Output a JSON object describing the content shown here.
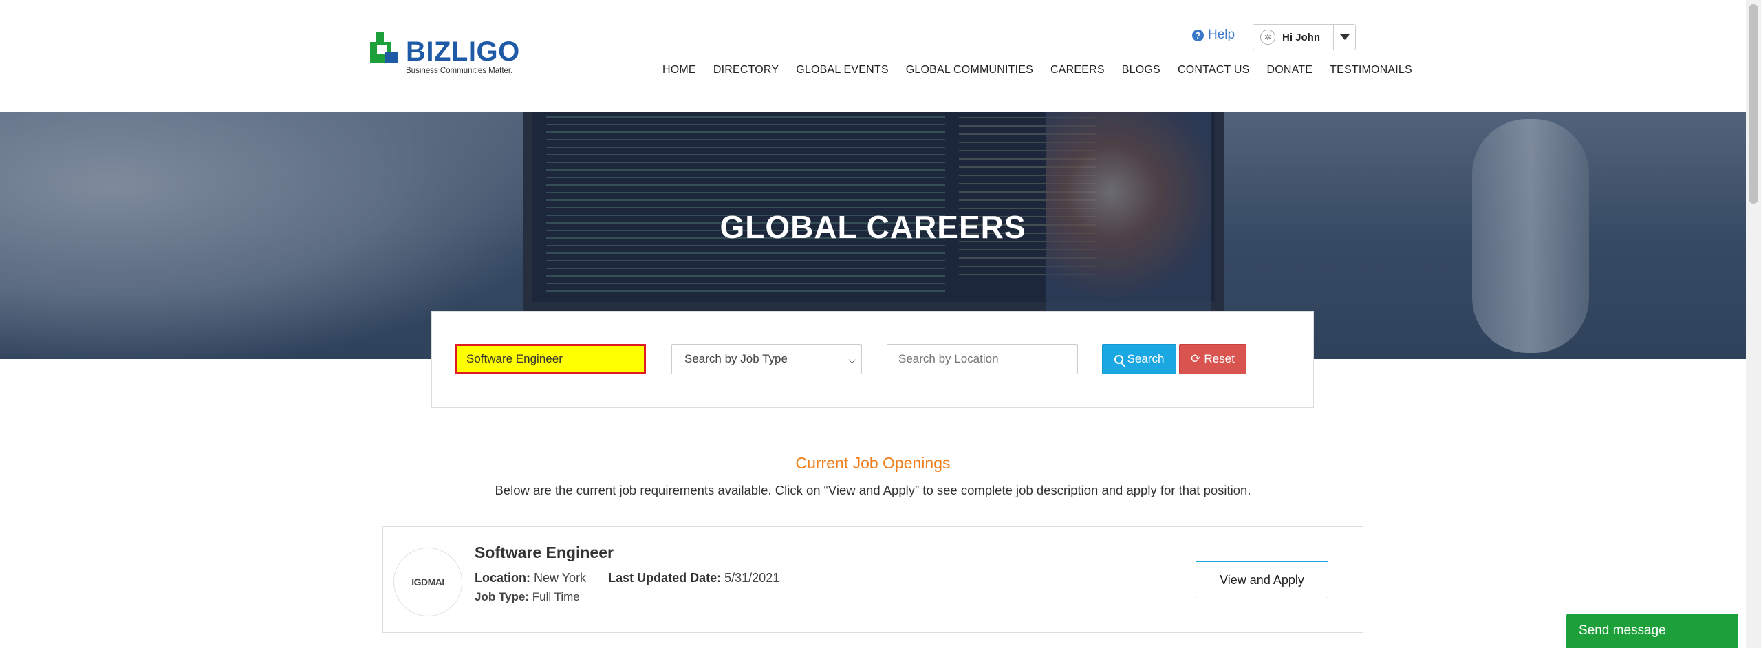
{
  "header": {
    "logo_text": "BIZLIGO",
    "logo_tagline": "Business Communities Matter.",
    "help_label": "Help",
    "user_label": "Hi John",
    "nav": [
      "HOME",
      "DIRECTORY",
      "GLOBAL EVENTS",
      "GLOBAL COMMUNITIES",
      "CAREERS",
      "BLOGS",
      "CONTACT US",
      "DONATE",
      "TESTIMONAILS"
    ]
  },
  "hero": {
    "title": "GLOBAL CAREERS"
  },
  "search": {
    "keyword_value": "Software Engineer",
    "job_type_selected": "Search by Job Type",
    "location_placeholder": "Search by Location",
    "search_label": "Search",
    "reset_label": "Reset"
  },
  "openings": {
    "title": "Current Job Openings",
    "description": "Below are the current job requirements available. Click on “View and Apply” to see complete job description and apply for that position."
  },
  "jobs": [
    {
      "logo_text": "IGDMAI",
      "title": "Software Engineer",
      "location_label": "Location:",
      "location": "New York",
      "updated_label": "Last Updated Date:",
      "updated": "5/31/2021",
      "type_label": "Job Type:",
      "type": "Full Time",
      "action_label": "View and Apply"
    }
  ],
  "chat": {
    "label": "Send message"
  },
  "colors": {
    "brand_blue": "#1f5aa6",
    "logo_green": "#1d9f3a",
    "accent_orange": "#f07d1a",
    "search_blue": "#1ba7e1",
    "reset_red": "#d9534f"
  }
}
